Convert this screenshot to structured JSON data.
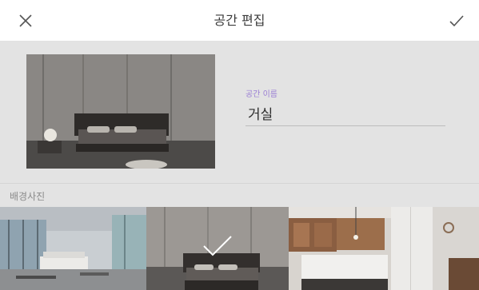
{
  "header": {
    "title": "공간 편집",
    "close_icon": "close-icon",
    "confirm_icon": "check-icon"
  },
  "edit": {
    "name_label": "공간 이름",
    "name_value": "거실"
  },
  "background": {
    "section_label": "배경사진",
    "options": [
      {
        "name": "living-room-photo",
        "selected": false
      },
      {
        "name": "bedroom-photo",
        "selected": true
      },
      {
        "name": "kitchen-photo",
        "selected": false
      }
    ]
  },
  "colors": {
    "accent_label": "#9b7fd4",
    "section_bg": "#e3e3e3"
  }
}
